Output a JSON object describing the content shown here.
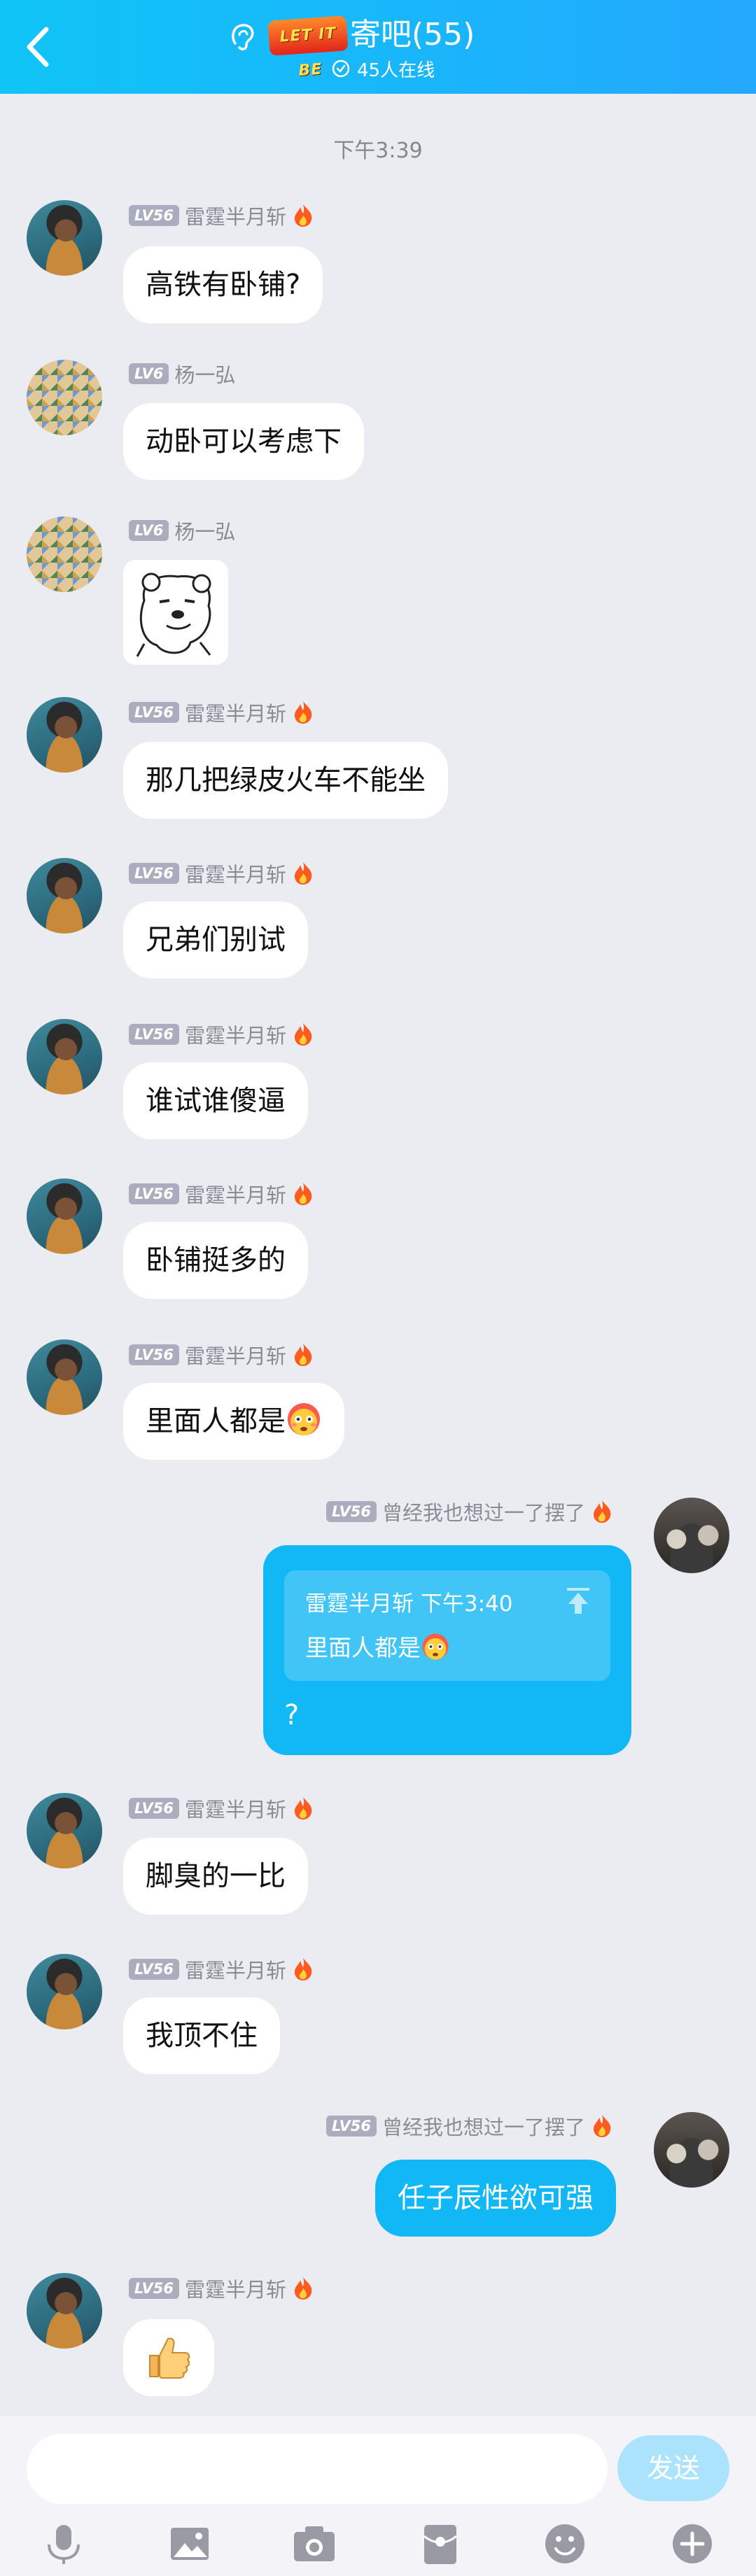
{
  "header": {
    "logo_text": "LET IT BE",
    "title": "寄吧(55)",
    "online": "45人在线",
    "accent": "#12b7f5"
  },
  "timestamp": "下午3:39",
  "messages": [
    {
      "level": "LV56",
      "name": "雷霆半月斩",
      "text": "高铁有卧铺?"
    },
    {
      "level": "LV6",
      "name": "杨一弘",
      "text": "动卧可以考虑下"
    },
    {
      "level": "LV6",
      "name": "杨一弘",
      "sticker": "bear-sticker"
    },
    {
      "level": "LV56",
      "name": "雷霆半月斩",
      "text": "那几把绿皮火车不能坐"
    },
    {
      "level": "LV56",
      "name": "雷霆半月斩",
      "text": "兄弟们别试"
    },
    {
      "level": "LV56",
      "name": "雷霆半月斩",
      "text": "谁试谁傻逼"
    },
    {
      "level": "LV56",
      "name": "雷霆半月斩",
      "text": "卧铺挺多的"
    },
    {
      "level": "LV56",
      "name": "雷霆半月斩",
      "text": "里面人都是"
    },
    {
      "level": "LV56",
      "name": "曾经我也想过一了摆了",
      "quote_author": "雷霆半月斩",
      "quote_time": "下午3:40",
      "quote_text": "里面人都是",
      "text": "?"
    },
    {
      "level": "LV56",
      "name": "雷霆半月斩",
      "text": "脚臭的一比"
    },
    {
      "level": "LV56",
      "name": "雷霆半月斩",
      "text": "我顶不住"
    },
    {
      "level": "LV56",
      "name": "曾经我也想过一了摆了",
      "text": "任子辰性欲可强"
    },
    {
      "level": "LV56",
      "name": "雷霆半月斩",
      "emoji": "thumbs-up-icon"
    }
  ],
  "input": {
    "placeholder": "",
    "send_label": "发送"
  },
  "toolbar": [
    "voice-icon",
    "image-icon",
    "camera-icon",
    "red-packet-icon",
    "emoji-icon",
    "plus-icon"
  ]
}
